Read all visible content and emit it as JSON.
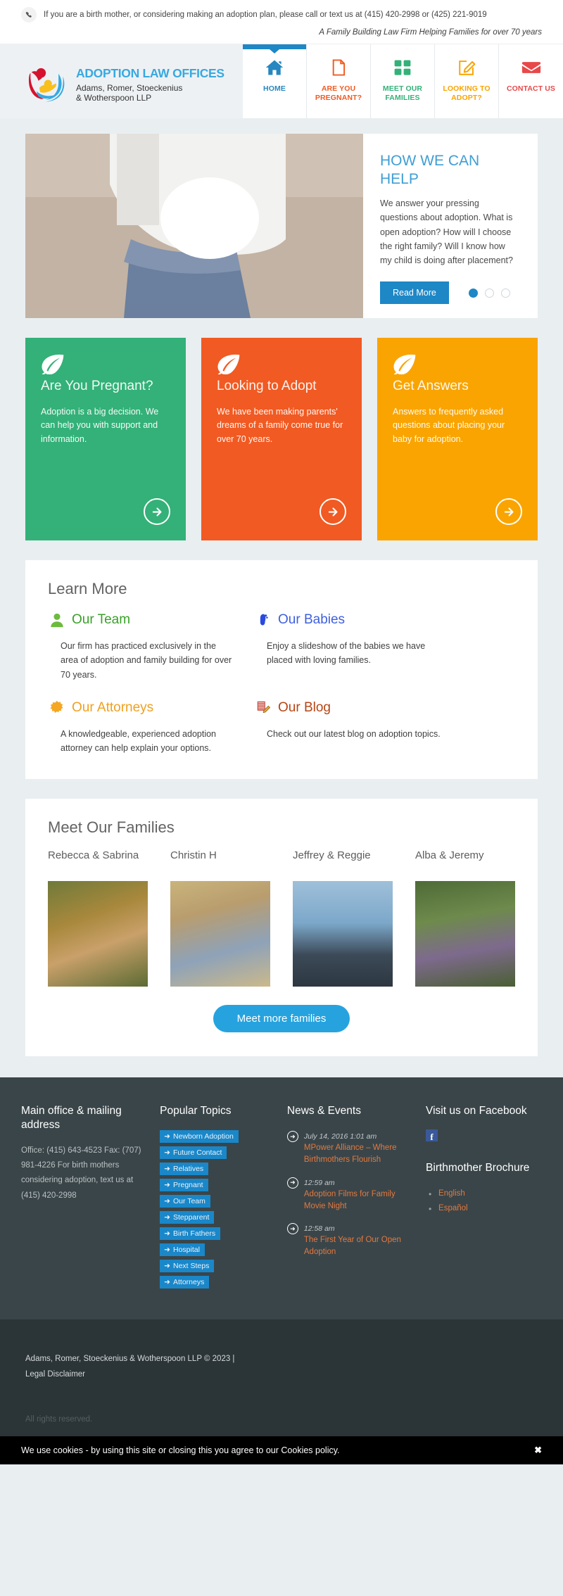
{
  "topbar": {
    "phone_icon": "phone-icon",
    "notice": "If you are a birth mother, or considering making an adoption plan, please call or text us at (415) 420-2998 or (425) 221-9019",
    "tagline": "A Family Building Law Firm Helping Families for over 70 years"
  },
  "header": {
    "logo_main": "ADOPTION LAW OFFICES",
    "logo_sub_line1": "Adams, Romer, Stoeckenius",
    "logo_sub_line2": "& Wotherspoon LLP",
    "nav": [
      {
        "label": "HOME",
        "icon": "home-icon",
        "color": "#2787c0",
        "active": true
      },
      {
        "label": "ARE YOU PREGNANT?",
        "icon": "document-icon",
        "color": "#f15a22",
        "active": false
      },
      {
        "label": "MEET OUR FAMILIES",
        "icon": "grid-icon",
        "color": "#33b178",
        "active": false
      },
      {
        "label": "LOOKING TO ADOPT?",
        "icon": "pencil-square-icon",
        "color": "#f9a400",
        "active": false
      },
      {
        "label": "CONTACT US",
        "icon": "envelope-icon",
        "color": "#e8484a",
        "active": false
      }
    ]
  },
  "hero": {
    "image_alt": "pregnant-woman-photo",
    "title": "HOW WE CAN HELP",
    "description": "We answer your pressing questions about adoption. What is open adoption? How will I choose the right family? Will I know how my child is doing after placement?",
    "button": "Read More",
    "slides": 3,
    "active_slide": 1
  },
  "cards": [
    {
      "title": "Are You Pregnant?",
      "desc": "Adoption is a big decision. We can help you with support and information.",
      "color": "#33b178",
      "icon": "leaf-icon",
      "arrow": "arrow-right-icon"
    },
    {
      "title": "Looking to Adopt",
      "desc": "We have been making parents' dreams of a family come true for over 70 years.",
      "color": "#f15a22",
      "icon": "leaf-icon",
      "arrow": "arrow-right-icon"
    },
    {
      "title": "Get Answers",
      "desc": "Answers to frequently asked questions about placing your baby for adoption.",
      "color": "#f9a400",
      "icon": "leaf-icon",
      "arrow": "arrow-right-icon"
    }
  ],
  "learn_more": {
    "title": "Learn More",
    "items": [
      {
        "name": "Our Team",
        "icon": "person-icon",
        "color": "#3aa02a",
        "desc": "Our firm has practiced exclusively in the area of adoption and family building for over 70 years."
      },
      {
        "name": "Our Babies",
        "icon": "footprint-icon",
        "color": "#3e5fe0",
        "desc": "Enjoy a slideshow of the babies we have placed with loving families."
      },
      {
        "name": "Our Attorneys",
        "icon": "sunburst-icon",
        "color": "#f0a020",
        "desc": "A knowledgeable, experienced adoption attorney can help explain your options."
      },
      {
        "name": "Our Blog",
        "icon": "notepad-pencil-icon",
        "color": "#b74514",
        "desc": "Check out our latest blog on adoption topics."
      }
    ]
  },
  "families": {
    "title": "Meet Our Families",
    "items": [
      {
        "name": "Rebecca & Sabrina",
        "photo": "family-photo-1"
      },
      {
        "name": "Christin H",
        "photo": "family-photo-2"
      },
      {
        "name": "Jeffrey & Reggie",
        "photo": "family-photo-3"
      },
      {
        "name": "Alba & Jeremy",
        "photo": "family-photo-4"
      }
    ],
    "button": "Meet more families"
  },
  "footer": {
    "office": {
      "title": "Main office & mailing address",
      "lines": "Office: (415) 643-4523\nFax: (707) 981-4226\nFor birth mothers considering adoption, text us at (415) 420-2998"
    },
    "topics": {
      "title": "Popular Topics",
      "items": [
        "Newborn Adoption",
        "Future Contact",
        "Relatives",
        "Pregnant",
        "Our Team",
        "Stepparent",
        "Birth Fathers",
        "Hospital",
        "Next Steps",
        "Attorneys"
      ]
    },
    "news": {
      "title": "News & Events",
      "items": [
        {
          "date": "July 14, 2016 1:01 am",
          "link": "MPower Alliance – Where Birthmothers Flourish"
        },
        {
          "date": "12:59 am",
          "link": "Adoption Films for Family Movie Night"
        },
        {
          "date": "12:58 am",
          "link": "The First Year of Our Open Adoption"
        }
      ]
    },
    "facebook": {
      "title": "Visit us on Facebook",
      "icon": "facebook-icon"
    },
    "brochure": {
      "title": "Birthmother Brochure",
      "items": [
        "English",
        "Español"
      ]
    }
  },
  "copyright": {
    "line1": "Adams, Romer, Stoeckenius & Wotherspoon LLP © 2023 |",
    "line2": "Legal Disclaimer",
    "rights": "All rights reserved."
  },
  "cookiebar": {
    "text": "We use cookies - by using this site or closing this you agree to our Cookies policy.",
    "close": "✖"
  }
}
